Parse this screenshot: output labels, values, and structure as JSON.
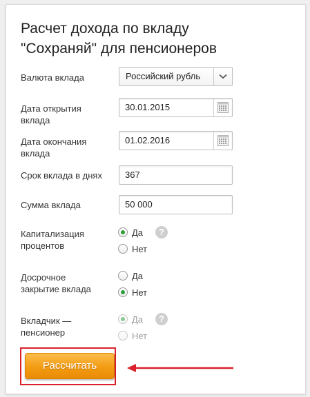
{
  "form": {
    "title_line1": "Расчет дохода по вкладу",
    "title_line2": "\"Сохраняй\" для пенсионеров",
    "currency": {
      "label": "Валюта вклада",
      "value": "Российский рубль"
    },
    "open_date": {
      "label_line1": "Дата открытия",
      "label_line2": "вклада",
      "value": "30.01.2015"
    },
    "close_date": {
      "label_line1": "Дата окончания",
      "label_line2": "вклада",
      "value": "01.02.2016"
    },
    "term": {
      "label": "Срок вклада в днях",
      "value": "367"
    },
    "amount": {
      "label": "Сумма вклада",
      "value": "50 000"
    },
    "capitalization": {
      "label_line1": "Капитализация",
      "label_line2": "процентов",
      "yes": "Да",
      "no": "Нет",
      "selected": "yes",
      "help": "?"
    },
    "early_close": {
      "label_line1": "Досрочное",
      "label_line2": "закрытие вклада",
      "yes": "Да",
      "no": "Нет",
      "selected": "no"
    },
    "pensioner": {
      "label_line1": "Вкладчик —",
      "label_line2": "пенсионер",
      "yes": "Да",
      "no": "Нет",
      "selected": "yes",
      "disabled": true,
      "help": "?"
    },
    "calculate_label": "Рассчитать"
  },
  "colors": {
    "accent_orange": "#f39c12",
    "highlight_red": "#d9202b",
    "radio_green": "#2e9d3a"
  }
}
